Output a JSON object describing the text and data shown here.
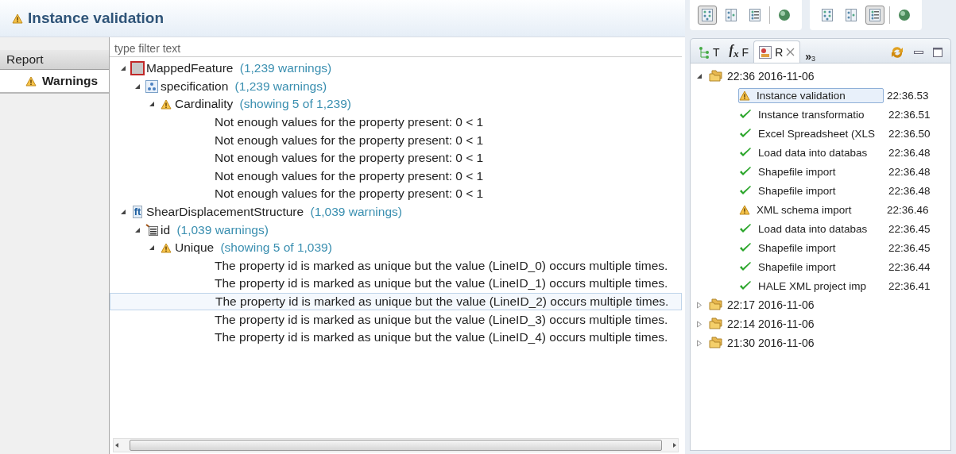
{
  "title": {
    "text": "Instance validation"
  },
  "sidebar": {
    "items": [
      {
        "label": "Report",
        "kind": "header",
        "selected": false
      },
      {
        "label": "Warnings",
        "kind": "item",
        "selected": true
      }
    ]
  },
  "filter": {
    "placeholder": "type filter text"
  },
  "tree": [
    {
      "kind": "type",
      "label": "MappedFeature",
      "count": "(1,239 warnings)",
      "expanded": true,
      "selected": false,
      "children": [
        {
          "kind": "property",
          "label": "specification",
          "count": "(1,239 warnings)",
          "expanded": true,
          "selected": false,
          "children": [
            {
              "kind": "warning",
              "label": "Cardinality",
              "count": "(showing 5 of 1,239)",
              "expanded": true,
              "selected": false,
              "children": [
                {
                  "kind": "message",
                  "label": "Not enough values for the property present: 0 < 1",
                  "selected": false
                },
                {
                  "kind": "message",
                  "label": "Not enough values for the property present: 0 < 1",
                  "selected": false
                },
                {
                  "kind": "message",
                  "label": "Not enough values for the property present: 0 < 1",
                  "selected": false
                },
                {
                  "kind": "message",
                  "label": "Not enough values for the property present: 0 < 1",
                  "selected": false
                },
                {
                  "kind": "message",
                  "label": "Not enough values for the property present: 0 < 1",
                  "selected": false
                }
              ]
            }
          ]
        }
      ]
    },
    {
      "kind": "feature-type",
      "badge": "ft",
      "label": "ShearDisplacementStructure",
      "count": "(1,039 warnings)",
      "expanded": true,
      "selected": false,
      "children": [
        {
          "kind": "id-property",
          "label": "id",
          "count": "(1,039 warnings)",
          "expanded": true,
          "selected": false,
          "children": [
            {
              "kind": "warning",
              "label": "Unique",
              "count": "(showing 5 of 1,039)",
              "expanded": true,
              "selected": false,
              "children": [
                {
                  "kind": "message",
                  "label": "The property id is marked as unique but the value (LineID_0) occurs multiple times.",
                  "selected": false
                },
                {
                  "kind": "message",
                  "label": "The property id is marked as unique but the value (LineID_1) occurs multiple times.",
                  "selected": false
                },
                {
                  "kind": "message",
                  "label": "The property id is marked as unique but the value (LineID_2) occurs multiple times.",
                  "selected": true
                },
                {
                  "kind": "message",
                  "label": "The property id is marked as unique but the value (LineID_3) occurs multiple times.",
                  "selected": false
                },
                {
                  "kind": "message",
                  "label": "The property id is marked as unique but the value (LineID_4) occurs multiple times.",
                  "selected": false
                }
              ]
            }
          ]
        }
      ]
    }
  ],
  "toolbar": {
    "groups": [
      [
        {
          "kind": "grid",
          "pressed": true
        },
        {
          "kind": "columns",
          "pressed": false
        },
        {
          "kind": "list",
          "pressed": false
        },
        {
          "kind": "globe",
          "pressed": false
        }
      ],
      [
        {
          "kind": "grid",
          "pressed": false
        },
        {
          "kind": "columns",
          "pressed": false
        },
        {
          "kind": "list",
          "pressed": true
        },
        {
          "kind": "globe",
          "pressed": false
        }
      ]
    ]
  },
  "views": {
    "tabs": [
      {
        "label": "T",
        "kind": "tree",
        "selected": false
      },
      {
        "label": "F",
        "kind": "function",
        "symbol": "f$_{x}$",
        "selected": false
      },
      {
        "label": "R",
        "kind": "report",
        "selected": true,
        "closable": true
      }
    ],
    "overflow": {
      "symbol": "»",
      "count": "3"
    }
  },
  "reports": [
    {
      "label": "22:36 2016-11-06",
      "expanded": true,
      "children": [
        {
          "label": "Instance validation",
          "time": "22:36.53",
          "kind": "warning",
          "selected": true
        },
        {
          "label": "Instance transformatio",
          "time": "22:36.51",
          "kind": "ok",
          "selected": false
        },
        {
          "label": "Excel Spreadsheet (XLS",
          "time": "22:36.50",
          "kind": "ok",
          "selected": false
        },
        {
          "label": "Load data into databas",
          "time": "22:36.48",
          "kind": "ok",
          "selected": false
        },
        {
          "label": "Shapefile import",
          "time": "22:36.48",
          "kind": "ok",
          "selected": false
        },
        {
          "label": "Shapefile import",
          "time": "22:36.48",
          "kind": "ok",
          "selected": false
        },
        {
          "label": "XML schema import",
          "time": "22:36.46",
          "kind": "warning",
          "selected": false
        },
        {
          "label": "Load data into databas",
          "time": "22:36.45",
          "kind": "ok",
          "selected": false
        },
        {
          "label": "Shapefile import",
          "time": "22:36.45",
          "kind": "ok",
          "selected": false
        },
        {
          "label": "Shapefile import",
          "time": "22:36.44",
          "kind": "ok",
          "selected": false
        },
        {
          "label": "HALE XML project imp",
          "time": "22:36.41",
          "kind": "ok",
          "selected": false
        }
      ]
    },
    {
      "label": "22:17 2016-11-06",
      "expanded": false
    },
    {
      "label": "22:14 2016-11-06",
      "expanded": false
    },
    {
      "label": "21:30 2016-11-06",
      "expanded": false
    }
  ]
}
